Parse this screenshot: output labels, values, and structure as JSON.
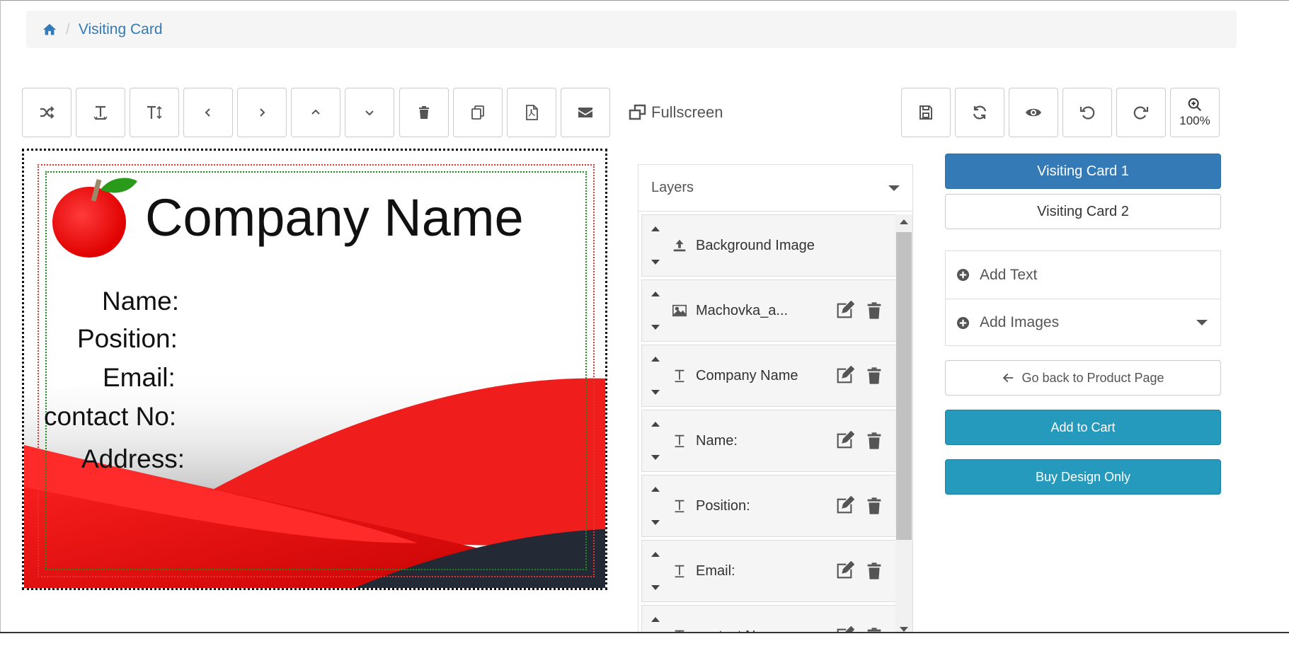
{
  "breadcrumb": {
    "current": "Visiting Card"
  },
  "toolbar": {
    "fullscreen_label": "Fullscreen",
    "zoom_level": "100%"
  },
  "card": {
    "company": "Company Name",
    "name_label": "Name:",
    "position_label": "Position:",
    "email_label": "Email:",
    "contact_label": "contact No:",
    "address_label": "Address:"
  },
  "layers": {
    "title": "Layers",
    "items": [
      {
        "label": "Background Image",
        "icon": "upload-icon"
      },
      {
        "label": "Machovka_a...",
        "icon": "image-icon"
      },
      {
        "label": "Company Name",
        "icon": "text-icon"
      },
      {
        "label": "Name:",
        "icon": "text-icon"
      },
      {
        "label": "Position:",
        "icon": "text-icon"
      },
      {
        "label": "Email:",
        "icon": "text-icon"
      },
      {
        "label": "contact No:",
        "icon": "text-icon"
      }
    ]
  },
  "right": {
    "card1": "Visiting Card 1",
    "card2": "Visiting Card 2",
    "add_text": "Add Text",
    "add_images": "Add Images",
    "go_back": "Go back to Product Page",
    "add_to_cart": "Add to Cart",
    "buy_design": "Buy Design Only"
  },
  "colors": {
    "primary": "#337ab7",
    "info": "#269abc",
    "card_red": "#f02020",
    "card_dark": "#232a35"
  }
}
